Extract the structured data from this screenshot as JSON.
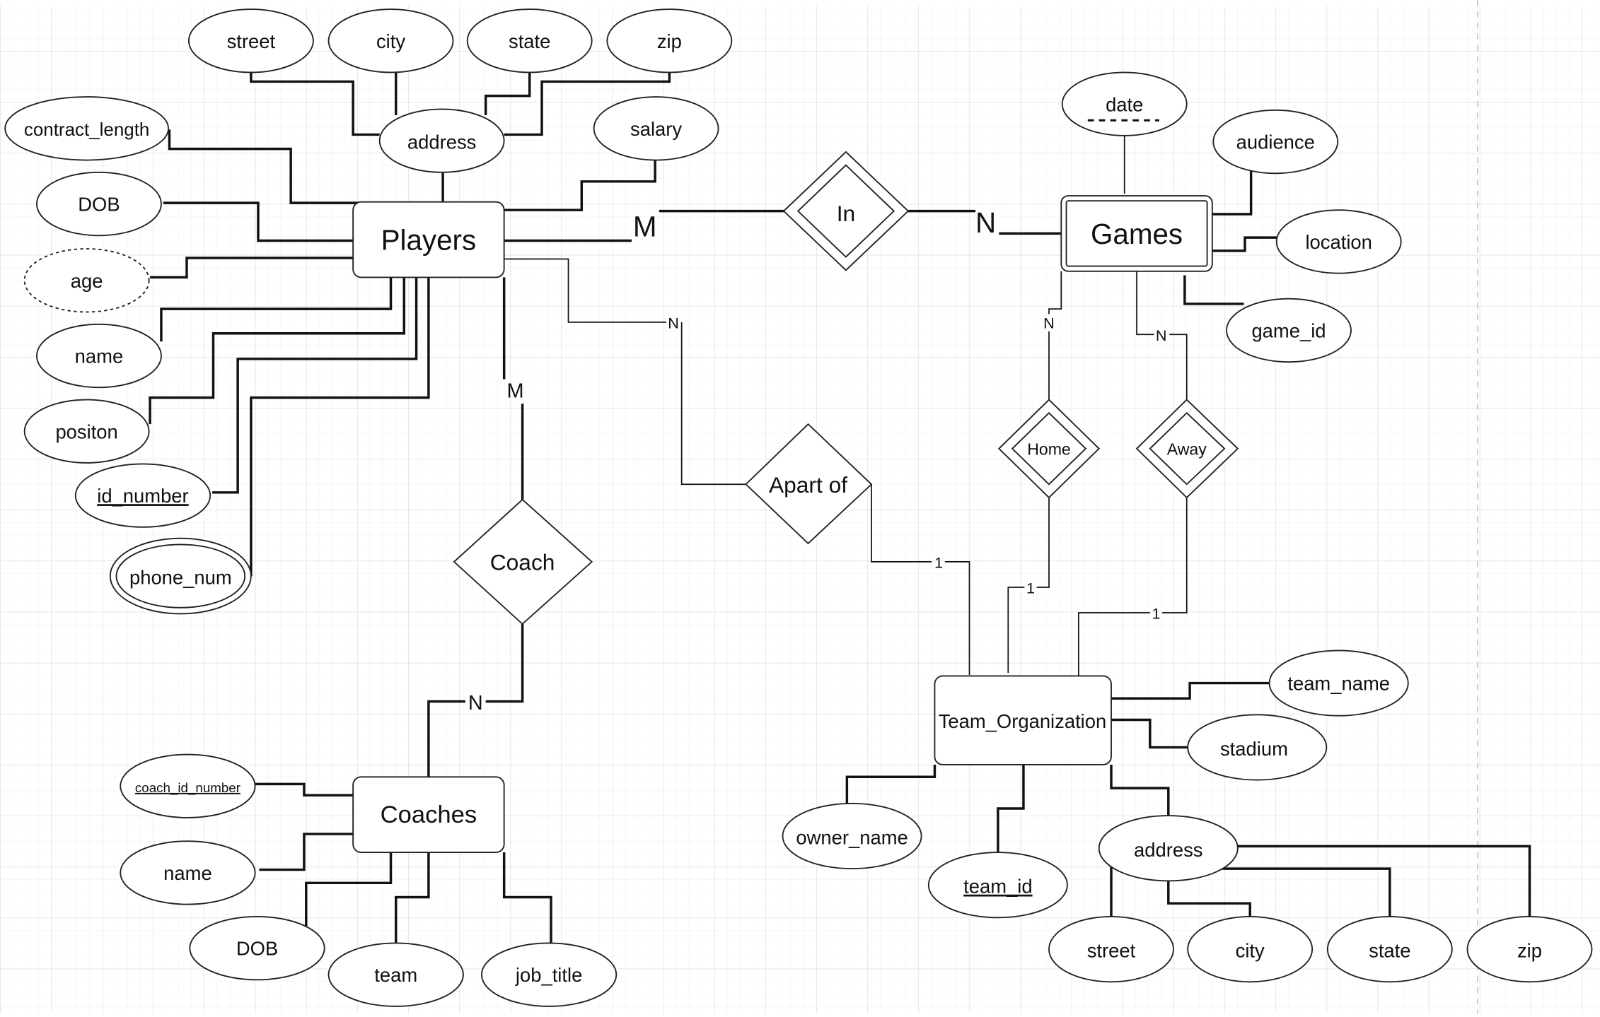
{
  "diagram": {
    "type": "ER diagram",
    "colors": {
      "background": "#ffffff",
      "grid_minor": "#ececec",
      "grid_major": "#dcdcdc",
      "stroke": "#111111"
    },
    "entities": [
      {
        "id": "players",
        "label": "Players",
        "kind": "strong"
      },
      {
        "id": "games",
        "label": "Games",
        "kind": "weak"
      },
      {
        "id": "coaches",
        "label": "Coaches",
        "kind": "strong"
      },
      {
        "id": "team_org",
        "label": "Team_Organization",
        "kind": "strong"
      }
    ],
    "relationships": [
      {
        "id": "in",
        "label": "In",
        "kind": "identifying"
      },
      {
        "id": "coach",
        "label": "Coach",
        "kind": "regular"
      },
      {
        "id": "apart_of",
        "label": "Apart of",
        "kind": "regular"
      },
      {
        "id": "home",
        "label": "Home",
        "kind": "identifying"
      },
      {
        "id": "away",
        "label": "Away",
        "kind": "identifying"
      }
    ],
    "attributes": {
      "p_street": {
        "label": "street",
        "kind": "simple"
      },
      "p_city": {
        "label": "city",
        "kind": "simple"
      },
      "p_state": {
        "label": "state",
        "kind": "simple"
      },
      "p_zip": {
        "label": "zip",
        "kind": "simple"
      },
      "p_address": {
        "label": "address",
        "kind": "composite"
      },
      "p_salary": {
        "label": "salary",
        "kind": "simple"
      },
      "p_contract_length": {
        "label": "contract_length",
        "kind": "simple"
      },
      "p_dob": {
        "label": "DOB",
        "kind": "simple"
      },
      "p_age": {
        "label": "age",
        "kind": "derived"
      },
      "p_name": {
        "label": "name",
        "kind": "simple"
      },
      "p_position": {
        "label": "positon",
        "kind": "simple"
      },
      "p_id_number": {
        "label": "id_number",
        "kind": "key"
      },
      "p_phone_num": {
        "label": "phone_num",
        "kind": "multivalued"
      },
      "g_date": {
        "label": "date",
        "kind": "partial-key"
      },
      "g_audience": {
        "label": "audience",
        "kind": "simple"
      },
      "g_location": {
        "label": "location",
        "kind": "simple"
      },
      "g_game_id": {
        "label": "game_id",
        "kind": "simple"
      },
      "c_coach_id_number": {
        "label": "coach_id_number",
        "kind": "key"
      },
      "c_name": {
        "label": "name",
        "kind": "simple"
      },
      "c_dob": {
        "label": "DOB",
        "kind": "simple"
      },
      "c_team": {
        "label": "team",
        "kind": "simple"
      },
      "c_job_title": {
        "label": "job_title",
        "kind": "simple"
      },
      "t_team_name": {
        "label": "team_name",
        "kind": "simple"
      },
      "t_stadium": {
        "label": "stadium",
        "kind": "simple"
      },
      "t_owner_name": {
        "label": "owner_name",
        "kind": "simple"
      },
      "t_team_id": {
        "label": "team_id",
        "kind": "key"
      },
      "t_address": {
        "label": "address",
        "kind": "composite"
      },
      "t_street": {
        "label": "street",
        "kind": "simple"
      },
      "t_city": {
        "label": "city",
        "kind": "simple"
      },
      "t_state": {
        "label": "state",
        "kind": "simple"
      },
      "t_zip": {
        "label": "zip",
        "kind": "simple"
      }
    },
    "cardinalities": {
      "players_in": "M",
      "games_in": "N",
      "players_coach": "M",
      "coaches_coach": "N",
      "players_apart_of": "N",
      "team_apart_of": "1",
      "games_home": "N",
      "team_home": "1",
      "games_away": "N",
      "team_away": "1"
    }
  }
}
